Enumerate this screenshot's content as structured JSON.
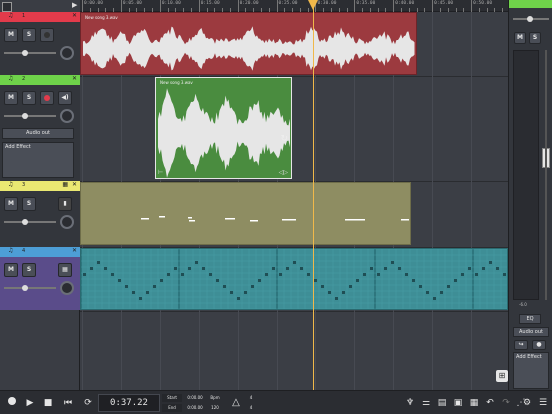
{
  "ruler": {
    "labels": [
      "0:00.00",
      "0:05.00",
      "0:10.00",
      "0:15.00",
      "0:20.00",
      "0:25.00",
      "0:30.00",
      "0:35.00",
      "0:40.00",
      "0:45.00",
      "0:50.00"
    ]
  },
  "tracks": [
    {
      "strip_color": "#e23b4b",
      "name": "1",
      "mute_label": "M",
      "solo_label": "S",
      "clip": {
        "title": "New song 3.wav",
        "color": "#9c3a3f"
      }
    },
    {
      "strip_color": "#6fd34a",
      "name": "2",
      "mute_label": "M",
      "solo_label": "S",
      "output_label": "Audio out",
      "effect_label": "Add Effect",
      "clip": {
        "title": "New song 3.wav",
        "color": "#4a8c3f"
      }
    },
    {
      "strip_color": "#eae872",
      "name": "3",
      "mute_label": "M",
      "solo_label": "S",
      "clip": {
        "title": "",
        "color": "#8e8d62"
      }
    },
    {
      "strip_color": "#4d9ed6",
      "name": "4",
      "mute_label": "M",
      "solo_label": "S",
      "clip": {
        "title": "",
        "color": "#3e8e96"
      }
    }
  ],
  "mixer": {
    "strip_color": "#6fd34a",
    "mute_label": "M",
    "solo_label": "S",
    "db_label": "-6.0",
    "eq_label": "EQ",
    "output_label": "Audio out",
    "effect_label": "Add Effect"
  },
  "transport": {
    "time": "0:37.22",
    "start_label": "Start",
    "end_label": "End",
    "start_value": "0:00.00",
    "end_value": "0:00.00",
    "bpm_label": "Bpm",
    "bpm_value": "120",
    "sig_top": "4",
    "sig_bottom": "4"
  },
  "colors": {
    "playhead": "#f0b84a",
    "waveform": "#e6e6e6",
    "midi_note": "#ffffff"
  }
}
